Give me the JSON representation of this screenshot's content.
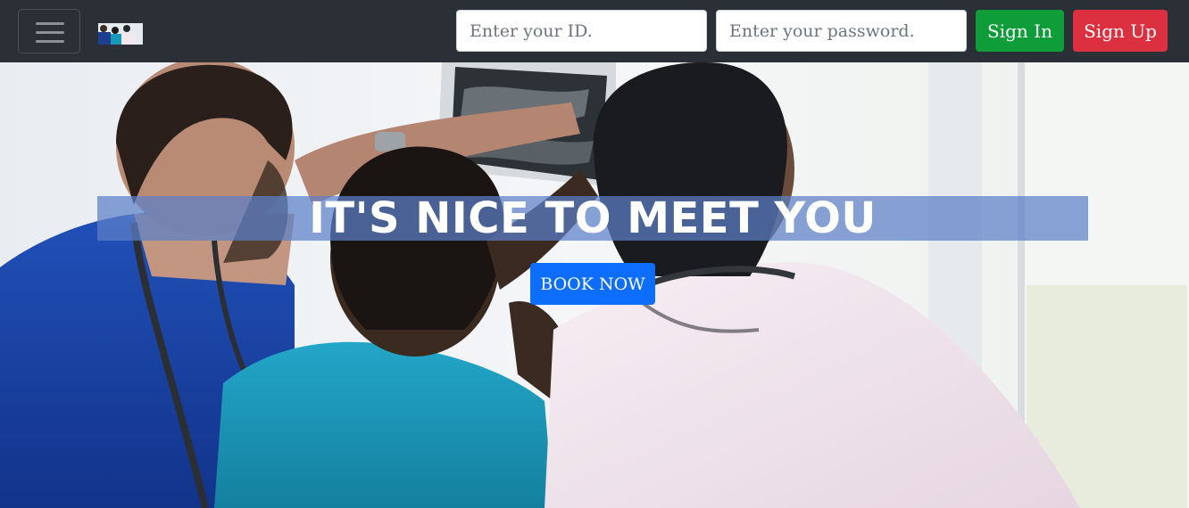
{
  "navbar": {
    "toggle_icon": "hamburger-icon",
    "brand_icon": "doctors-thumbnail",
    "id_input": {
      "placeholder": "Enter your ID.",
      "value": ""
    },
    "password_input": {
      "placeholder": "Enter your password.",
      "value": ""
    },
    "sign_in_label": "Sign In",
    "sign_up_label": "Sign Up",
    "colors": {
      "background": "#2b3036",
      "sign_in": "#0f9d3a",
      "sign_up": "#dc2f40"
    }
  },
  "hero": {
    "headline": "IT'S NICE TO MEET YOU",
    "book_button_label": "BOOK NOW",
    "image": "doctors-examining-xray-photo",
    "colors": {
      "headline_band": "#5c80c8",
      "book_button": "#0d6efd"
    }
  }
}
